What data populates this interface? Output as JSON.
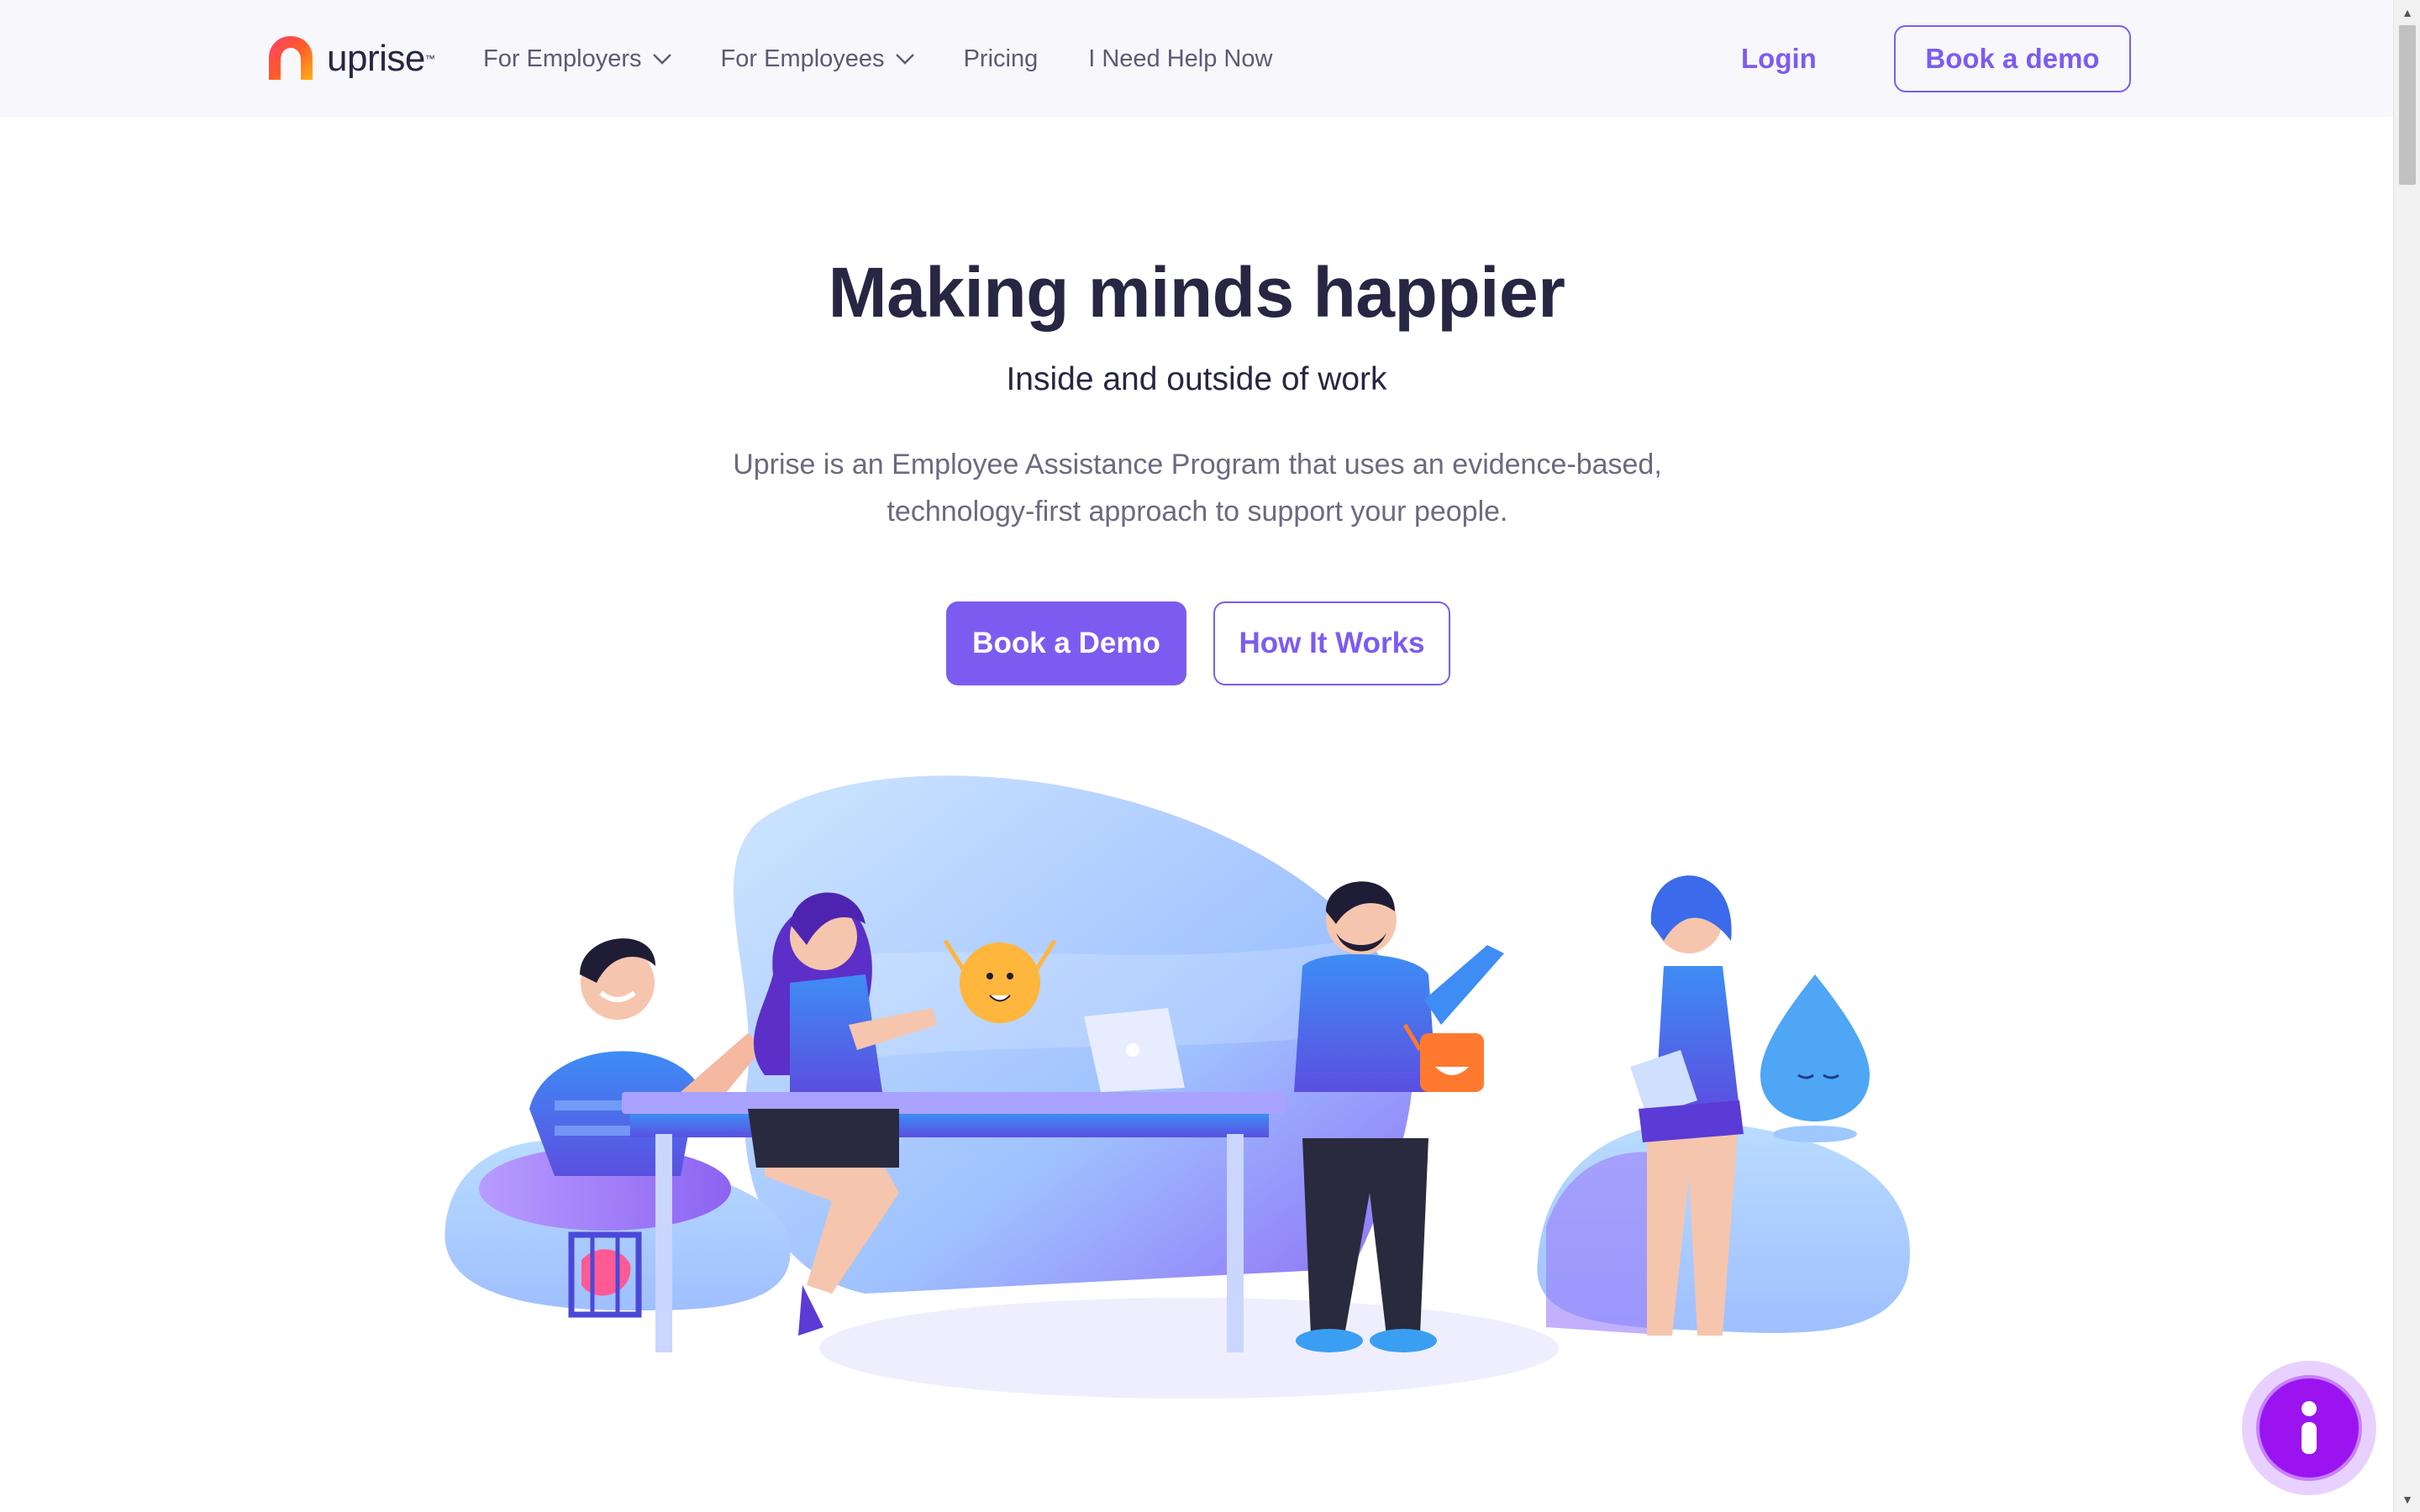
{
  "header": {
    "logo": {
      "text": "uprise",
      "trademark": "™",
      "icon": "uprise-logo-icon"
    },
    "nav": [
      {
        "label": "For Employers",
        "has_dropdown": true
      },
      {
        "label": "For Employees",
        "has_dropdown": true
      },
      {
        "label": "Pricing",
        "has_dropdown": false
      },
      {
        "label": "I Need Help Now",
        "has_dropdown": false
      }
    ],
    "login_label": "Login",
    "demo_label": "Book a demo"
  },
  "hero": {
    "title": "Making minds happier",
    "subtitle": "Inside and outside of work",
    "description_line1": "Uprise is an Employee Assistance Program that uses an evidence-based,",
    "description_line2": "technology-first approach to support your people.",
    "primary_cta": "Book a Demo",
    "secondary_cta": "How It Works"
  },
  "illustration": {
    "icon": "team-meeting-illustration"
  },
  "info_button": {
    "icon": "info-icon"
  },
  "colors": {
    "accent": "#7c5cf0",
    "header_bg": "#f7f7fc",
    "heading": "#272643",
    "body_text": "#6b6a80",
    "info_fab": "#9b14f0"
  }
}
